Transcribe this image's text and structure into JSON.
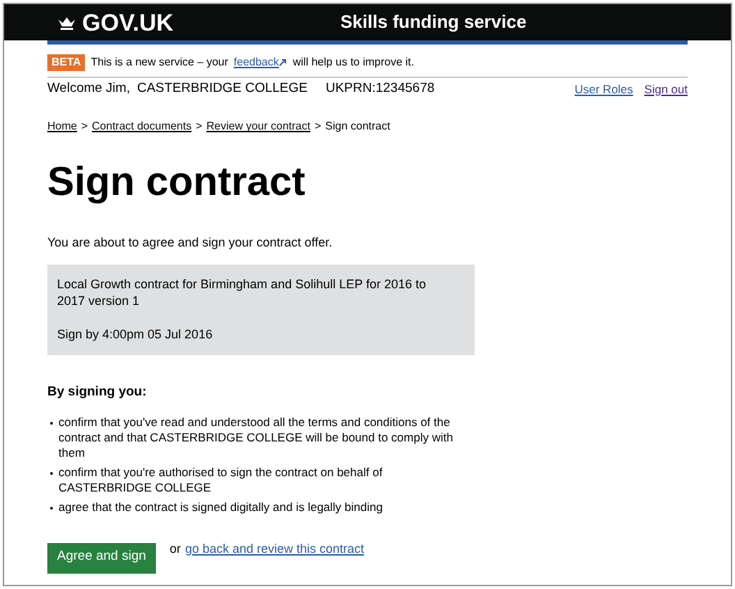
{
  "header": {
    "logo": "GOV.UK",
    "service": "Skills funding service"
  },
  "beta": {
    "tag": "BETA",
    "before": "This is a new service – your",
    "link": "feedback",
    "after": "will help us to improve it."
  },
  "account": {
    "welcome": "Welcome Jim,",
    "organisation": "CASTERBRIDGE COLLEGE",
    "ukprn": "UKPRN:12345678",
    "links": [
      "User Roles",
      "Sign out"
    ]
  },
  "breadcrumbs": [
    {
      "label": "Home",
      "link": true
    },
    {
      "label": "Contract documents",
      "link": true
    },
    {
      "label": "Review your contract",
      "link": true
    },
    {
      "label": "Sign contract",
      "link": false
    }
  ],
  "separator": ">",
  "title": "Sign contract",
  "intro": "You are about to agree and sign your contract offer.",
  "contract": {
    "name": "Local Growth contract for Birmingham and Solihull LEP for 2016 to 2017 version 1",
    "deadline": "Sign by 4:00pm 05 Jul 2016"
  },
  "terms_heading": "By signing you:",
  "terms": [
    "confirm that you've read and understood all the terms and conditions of the contract and that CASTERBRIDGE COLLEGE will be bound to comply with them",
    "confirm that you're authorised to sign the contract on behalf of CASTERBRIDGE COLLEGE",
    "agree that the contract is signed digitally and is legally binding"
  ],
  "submit": "Agree and sign",
  "alternative": {
    "text": "or",
    "link": "go back and review this contract"
  }
}
